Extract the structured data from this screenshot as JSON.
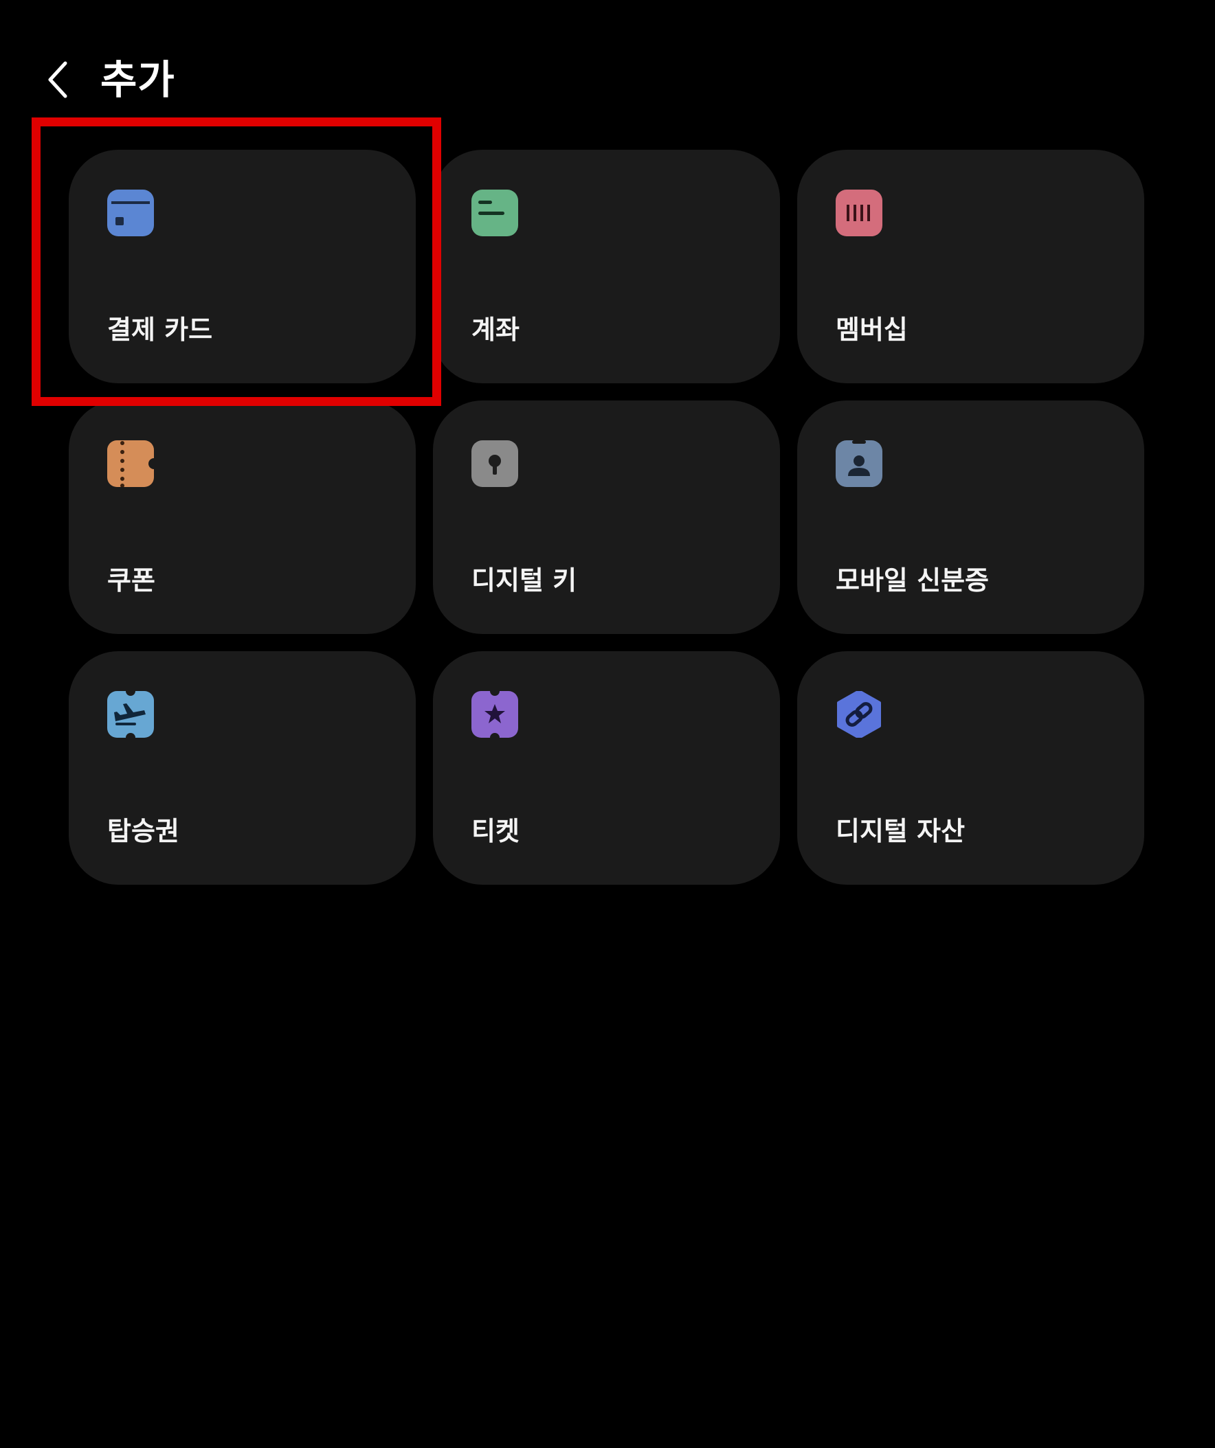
{
  "header": {
    "title": "추가",
    "back_icon": "chevron-left-icon"
  },
  "tiles": [
    {
      "label": "결제 카드",
      "icon": "credit-card-icon",
      "color": "#5b86d3"
    },
    {
      "label": "계좌",
      "icon": "bank-account-icon",
      "color": "#66b486"
    },
    {
      "label": "멤버십",
      "icon": "membership-barcode-icon",
      "color": "#d46d7c"
    },
    {
      "label": "쿠폰",
      "icon": "coupon-icon",
      "color": "#d58d58"
    },
    {
      "label": "디지털 키",
      "icon": "digital-key-icon",
      "color": "#8a8a8a"
    },
    {
      "label": "모바일 신분증",
      "icon": "mobile-id-icon",
      "color": "#6d86a6"
    },
    {
      "label": "탑승권",
      "icon": "boarding-pass-icon",
      "color": "#67a7d3"
    },
    {
      "label": "티켓",
      "icon": "ticket-icon",
      "color": "#8c66cf"
    },
    {
      "label": "디지털 자산",
      "icon": "digital-asset-link-icon",
      "color": "#5a74db"
    }
  ],
  "highlight": {
    "target": "결제 카드",
    "color": "#e00000"
  }
}
